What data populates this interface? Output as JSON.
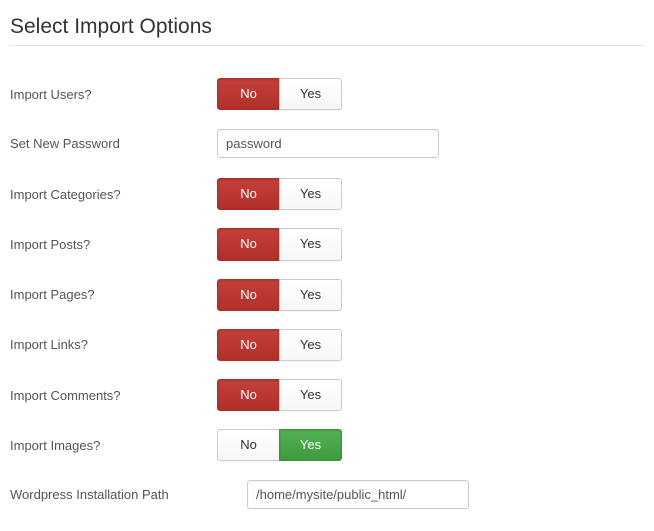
{
  "title": "Select Import Options",
  "toggles": {
    "no": "No",
    "yes": "Yes"
  },
  "rows": {
    "users": {
      "label": "Import Users?",
      "selected": "no"
    },
    "password": {
      "label": "Set New Password",
      "value": "password"
    },
    "categories": {
      "label": "Import Categories?",
      "selected": "no"
    },
    "posts": {
      "label": "Import Posts?",
      "selected": "no"
    },
    "pages": {
      "label": "Import Pages?",
      "selected": "no"
    },
    "links": {
      "label": "Import Links?",
      "selected": "no"
    },
    "comments": {
      "label": "Import Comments?",
      "selected": "no"
    },
    "images": {
      "label": "Import Images?",
      "selected": "yes"
    },
    "wp_path": {
      "label": "Wordpress Installation Path",
      "value": "/home/mysite/public_html/"
    }
  }
}
